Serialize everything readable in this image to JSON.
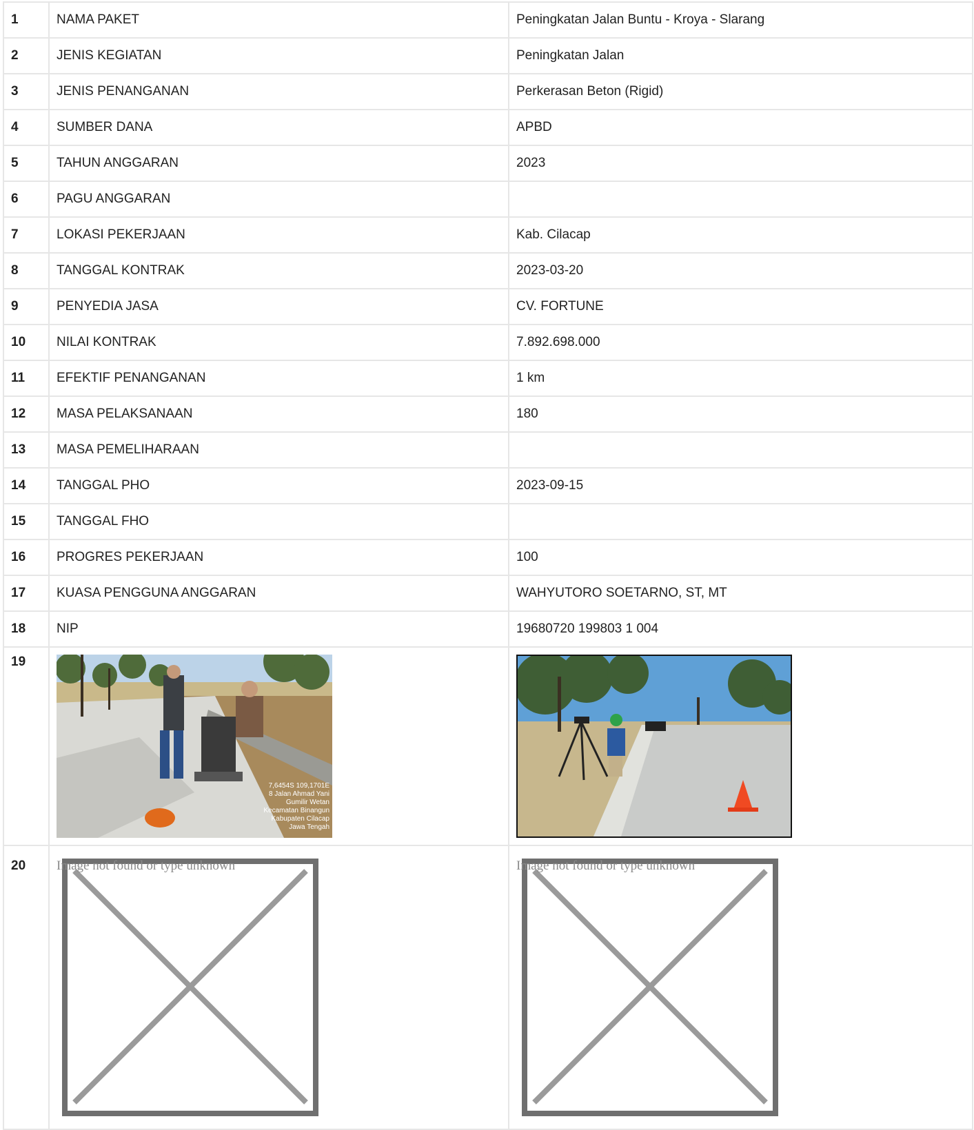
{
  "rows": [
    {
      "num": "1",
      "label": "NAMA PAKET",
      "value": "Peningkatan Jalan Buntu - Kroya - Slarang"
    },
    {
      "num": "2",
      "label": "JENIS KEGIATAN",
      "value": "Peningkatan Jalan"
    },
    {
      "num": "3",
      "label": "JENIS PENANGANAN",
      "value": "Perkerasan Beton (Rigid)"
    },
    {
      "num": "4",
      "label": "SUMBER DANA",
      "value": "APBD"
    },
    {
      "num": "5",
      "label": "TAHUN ANGGARAN",
      "value": "2023"
    },
    {
      "num": "6",
      "label": "PAGU ANGGARAN",
      "value": ""
    },
    {
      "num": "7",
      "label": "LOKASI PEKERJAAN",
      "value": "Kab. Cilacap"
    },
    {
      "num": "8",
      "label": "TANGGAL KONTRAK",
      "value": "2023-03-20"
    },
    {
      "num": "9",
      "label": "PENYEDIA JASA",
      "value": "CV. FORTUNE"
    },
    {
      "num": "10",
      "label": "NILAI KONTRAK",
      "value": "7.892.698.000"
    },
    {
      "num": "11",
      "label": "EFEKTIF PENANGANAN",
      "value": "1 km"
    },
    {
      "num": "12",
      "label": "MASA PELAKSANAAN",
      "value": "180"
    },
    {
      "num": "13",
      "label": "MASA PEMELIHARAAN",
      "value": ""
    },
    {
      "num": "14",
      "label": "TANGGAL PHO",
      "value": "2023-09-15"
    },
    {
      "num": "15",
      "label": "TANGGAL FHO",
      "value": ""
    },
    {
      "num": "16",
      "label": "PROGRES PEKERJAAN",
      "value": "100"
    },
    {
      "num": "17",
      "label": "KUASA PENGGUNA ANGGARAN",
      "value": "WAHYUTORO SOETARNO, ST, MT"
    },
    {
      "num": "18",
      "label": "NIP",
      "value": "19680720 199803 1 004"
    }
  ],
  "photo_row": {
    "num": "19",
    "photo1_caption": [
      "7,6454S 109,1701E",
      "8 Jalan Ahmad Yani",
      "Gumilir Wetan",
      "Kecamatan Binangun",
      "Kabupaten Cilacap",
      "Jawa Tengah"
    ]
  },
  "missing_row": {
    "num": "20",
    "alt_text": "Image not found or type unknown"
  }
}
